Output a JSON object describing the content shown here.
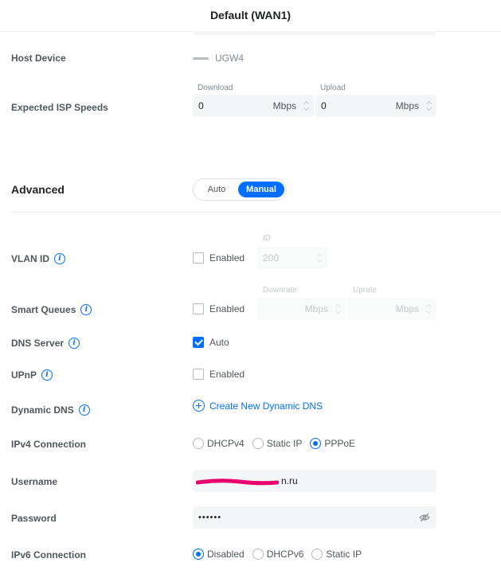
{
  "header": {
    "title": "Default (WAN1)"
  },
  "host_device": {
    "label": "Host Device",
    "value": "UGW4"
  },
  "isp_speeds": {
    "label": "Expected ISP Speeds",
    "download": {
      "label": "Download",
      "value": "0",
      "unit": "Mbps"
    },
    "upload": {
      "label": "Upload",
      "value": "0",
      "unit": "Mbps"
    }
  },
  "advanced": {
    "label": "Advanced",
    "options": [
      "Auto",
      "Manual"
    ],
    "selected": "Manual"
  },
  "vlan": {
    "label": "VLAN ID",
    "checkbox_label": "Enabled",
    "checked": false,
    "id_label": "ID",
    "id_value": "200"
  },
  "smart_queues": {
    "label": "Smart Queues",
    "checkbox_label": "Enabled",
    "checked": false,
    "downrate": {
      "label": "Downrate",
      "unit": "Mbps"
    },
    "uprate": {
      "label": "Uprate",
      "unit": "Mbps"
    }
  },
  "dns_server": {
    "label": "DNS Server",
    "checkbox_label": "Auto",
    "checked": true
  },
  "upnp": {
    "label": "UPnP",
    "checkbox_label": "Enabled",
    "checked": false
  },
  "dynamic_dns": {
    "label": "Dynamic DNS",
    "link": "Create New Dynamic DNS"
  },
  "ipv4": {
    "label": "IPv4 Connection",
    "options": [
      "DHCPv4",
      "Static IP",
      "PPPoE"
    ],
    "selected": "PPPoE"
  },
  "username": {
    "label": "Username",
    "value_suffix": "n.ru"
  },
  "password": {
    "label": "Password",
    "value": "••••••"
  },
  "ipv6": {
    "label": "IPv6 Connection",
    "options": [
      "Disabled",
      "DHCPv6",
      "Static IP"
    ],
    "selected": "Disabled"
  },
  "colors": {
    "accent": "#006fff",
    "redaction": "#e8006f"
  }
}
